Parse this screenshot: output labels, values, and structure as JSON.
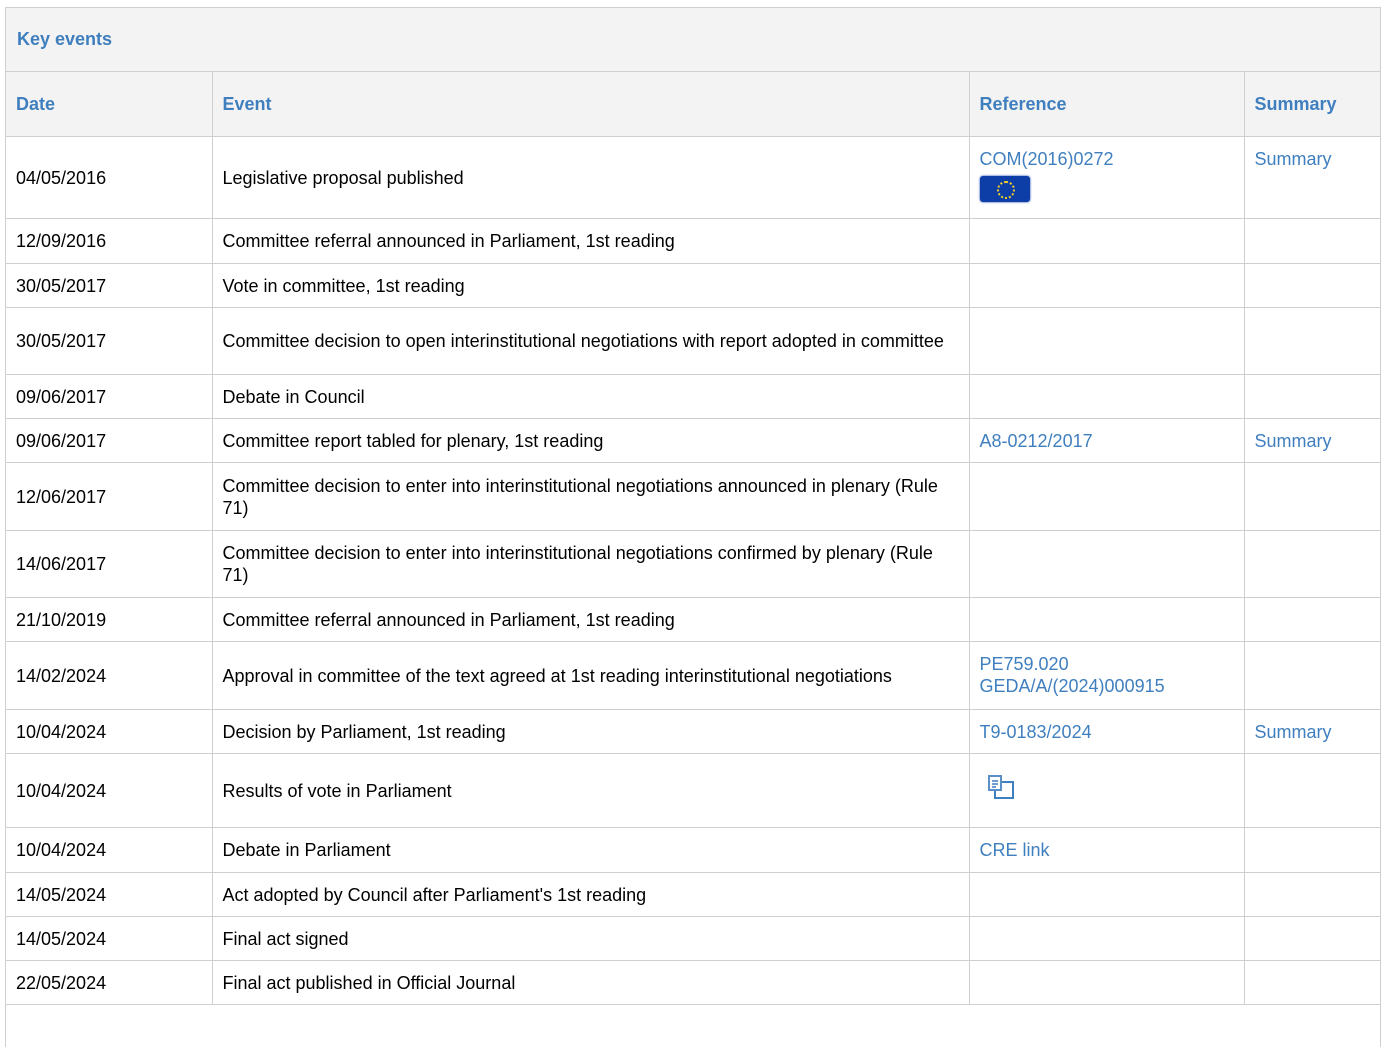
{
  "section_title": "Key events",
  "headers": {
    "date": "Date",
    "event": "Event",
    "reference": "Reference",
    "summary": "Summary"
  },
  "rows": [
    {
      "date": "04/05/2016",
      "event": "Legislative proposal published",
      "refs": [
        "COM(2016)0272"
      ],
      "ref_icon": "eu-flag-icon",
      "summary": "Summary"
    },
    {
      "date": "12/09/2016",
      "event": "Committee referral announced in Parliament, 1st reading",
      "refs": [],
      "summary": ""
    },
    {
      "date": "30/05/2017",
      "event": "Vote in committee, 1st reading",
      "refs": [],
      "summary": ""
    },
    {
      "date": "30/05/2017",
      "event": "Committee decision to open interinstitutional negotiations with report adopted in committee",
      "refs": [],
      "summary": ""
    },
    {
      "date": "09/06/2017",
      "event": "Debate in Council",
      "refs": [],
      "summary": ""
    },
    {
      "date": "09/06/2017",
      "event": "Committee report tabled for plenary, 1st reading",
      "refs": [
        "A8-0212/2017"
      ],
      "summary": "Summary"
    },
    {
      "date": "12/06/2017",
      "event": "Committee decision to enter into interinstitutional negotiations announced in plenary (Rule 71)",
      "refs": [],
      "summary": ""
    },
    {
      "date": "14/06/2017",
      "event": "Committee decision to enter into interinstitutional negotiations confirmed by plenary (Rule 71)",
      "refs": [],
      "summary": ""
    },
    {
      "date": "21/10/2019",
      "event": "Committee referral announced in Parliament, 1st reading",
      "refs": [],
      "summary": ""
    },
    {
      "date": "14/02/2024",
      "event": "Approval in committee of the text agreed at 1st reading interinstitutional negotiations",
      "refs": [
        "PE759.020",
        "GEDA/A/(2024)000915"
      ],
      "summary": ""
    },
    {
      "date": "10/04/2024",
      "event": "Decision by Parliament, 1st reading",
      "refs": [
        "T9-0183/2024"
      ],
      "summary": "Summary"
    },
    {
      "date": "10/04/2024",
      "event": "Results of vote in Parliament",
      "refs": [],
      "ref_icon": "vote-results-icon",
      "summary": ""
    },
    {
      "date": "10/04/2024",
      "event": "Debate in Parliament",
      "refs": [
        "CRE link"
      ],
      "summary": ""
    },
    {
      "date": "14/05/2024",
      "event": "Act adopted by Council after Parliament's 1st reading",
      "refs": [],
      "summary": ""
    },
    {
      "date": "14/05/2024",
      "event": "Final act signed",
      "refs": [],
      "summary": ""
    },
    {
      "date": "22/05/2024",
      "event": "Final act published in Official Journal",
      "refs": [],
      "summary": ""
    }
  ],
  "colors": {
    "link": "#3f7fbf",
    "header_bg": "#f3f3f3",
    "border": "#cfcfcf",
    "eu_flag_blue": "#0d3ea8",
    "eu_flag_stars": "#f2d024"
  }
}
